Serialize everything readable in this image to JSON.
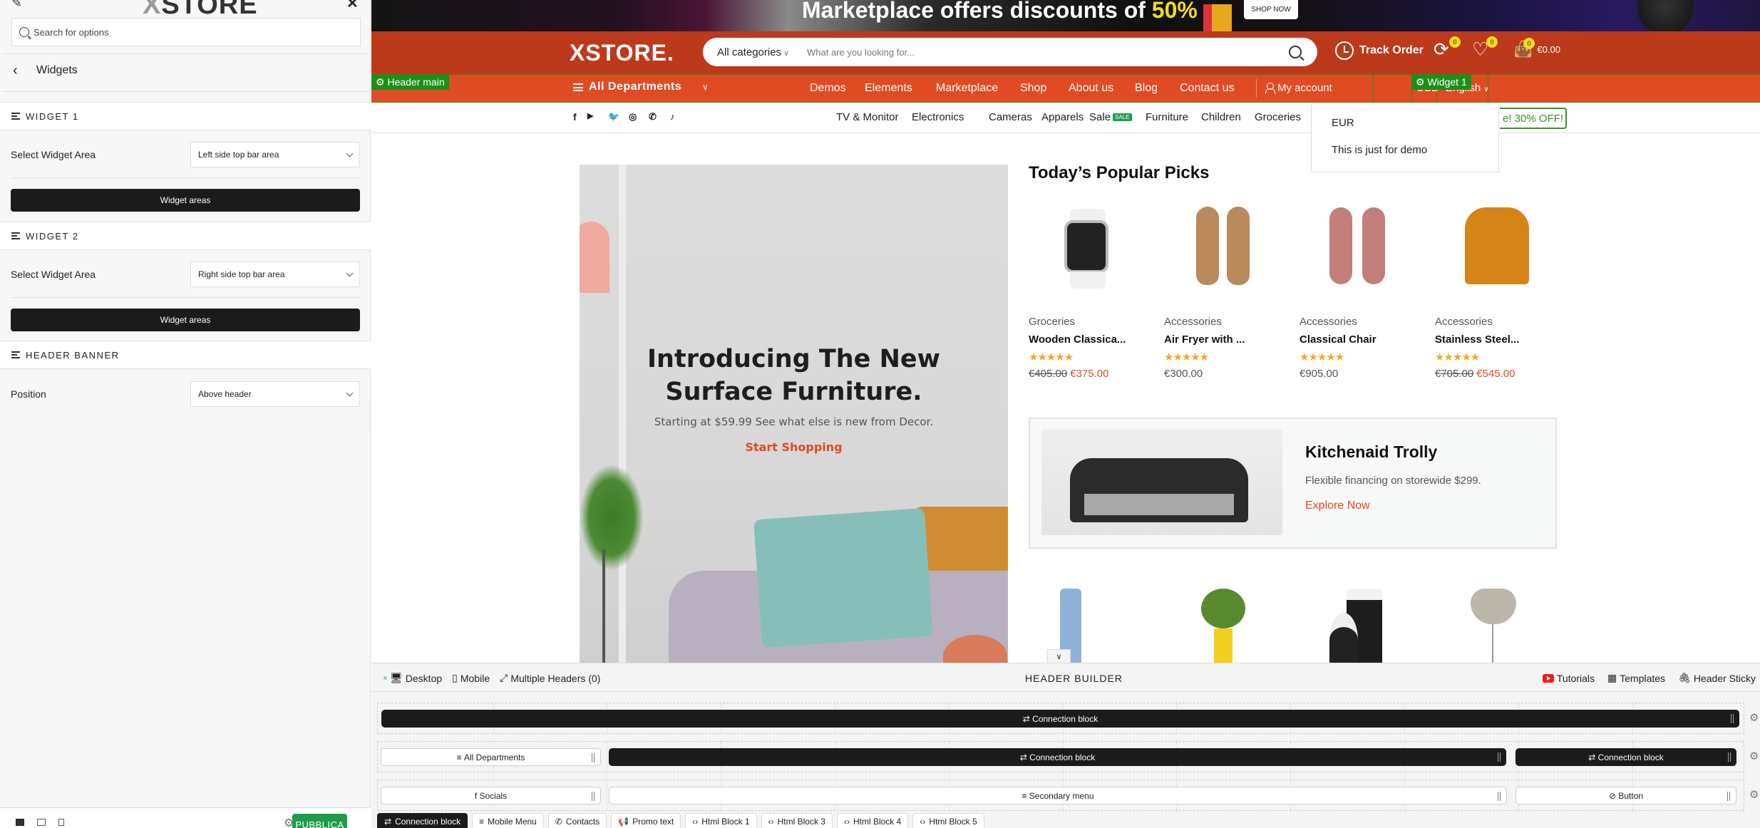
{
  "sidebar": {
    "logo": {
      "x": "X",
      "rest": "STORE"
    },
    "search_placeholder": "Search for options",
    "panel_title": "Widgets",
    "sections": [
      {
        "title": "WIDGET 1",
        "option_label": "Select Widget Area",
        "option_value": "Left side top bar area",
        "button": "Widget areas"
      },
      {
        "title": "WIDGET 2",
        "option_label": "Select Widget Area",
        "option_value": "Right side top bar area",
        "button": "Widget areas"
      },
      {
        "title": "HEADER BANNER",
        "option_label": "Position",
        "option_value": "Above header"
      }
    ],
    "publish_label": "PUBBLICA"
  },
  "preview": {
    "promo": {
      "text": "Marketplace offers discounts of ",
      "highlight": "50%",
      "button": "SHOP NOW"
    },
    "header": {
      "logo": "XSTORE.",
      "category_select": "All categories",
      "search_placeholder": "What are you looking for...",
      "track_order": "Track Order",
      "compare_count": "0",
      "wishlist_count": "0",
      "cart_count": "0",
      "cart_total": "€0.00"
    },
    "nav": {
      "tag_header_main": "Header main",
      "tag_widget": "Widget 1",
      "departments": "All Departments",
      "links": [
        "Demos",
        "Elements",
        "Marketplace",
        "Shop",
        "About us",
        "Blog",
        "Contact us"
      ],
      "account": "My account",
      "currency": "USD",
      "language": "English"
    },
    "bottom": {
      "categories": [
        "TV & Monitor",
        "Electronics",
        "Cameras",
        "Apparels",
        "Sale",
        "Furniture",
        "Children",
        "Groceries"
      ],
      "sale_badge": "SALE",
      "offer_button": "e! 30% OFF!"
    },
    "currency_dropdown": [
      "EUR",
      "This is just for demo"
    ],
    "hero": {
      "title_line1": "Introducing The New",
      "title_line2": "Surface Furniture.",
      "subtitle": "Starting at $59.99 See what else is new from Decor.",
      "link": "Start Shopping"
    },
    "popular": {
      "title": "Today’s Popular Picks",
      "products": [
        {
          "category": "Groceries",
          "name": "Wooden Classica...",
          "rating": 5,
          "stars": "★★★★★",
          "old_price": "€405.00",
          "price": "€375.00",
          "image": "watch"
        },
        {
          "category": "Accessories",
          "name": "Air Fryer with ...",
          "rating": 5,
          "stars": "★★★★★",
          "old_price": "",
          "price": "€300.00",
          "image": "loafers"
        },
        {
          "category": "Accessories",
          "name": "Classical Chair",
          "rating": 5,
          "stars": "★★★★★",
          "old_price": "",
          "price": "€905.00",
          "image": "sandals"
        },
        {
          "category": "Accessories",
          "name": "Stainless Steel...",
          "rating": 5,
          "stars": "★★★★★",
          "old_price": "€705.00",
          "price": "€545.00",
          "image": "hoodie"
        }
      ]
    },
    "kitchen": {
      "title": "Kitchenaid Trolly",
      "subtitle": "Flexible financing on storewide $299.",
      "link": "Explore Now"
    }
  },
  "builder": {
    "left": [
      "Desktop",
      "Mobile",
      "Multiple Headers (0)"
    ],
    "title": "HEADER BUILDER",
    "right": [
      "Tutorials",
      "Templates",
      "Header Sticky"
    ],
    "rows": [
      {
        "blocks": [
          "Connection block"
        ]
      },
      {
        "blocks": [
          "All Departments",
          "Connection block",
          "Connection block"
        ]
      },
      {
        "blocks": [
          "Socials",
          "Secondary menu",
          "Button"
        ]
      }
    ],
    "tabs": [
      "Connection block",
      "Mobile Menu",
      "Contacts",
      "Promo text",
      "Html Block 1",
      "Html Block 3",
      "Html Block 4",
      "Html Block 5"
    ]
  },
  "colors": {
    "brand_dark": "#bc391c",
    "brand": "#e14b23",
    "green_tag": "#1d8e1a",
    "publish": "#1e9c4c",
    "star": "#f5a623",
    "badge": "#f2dc1b"
  }
}
